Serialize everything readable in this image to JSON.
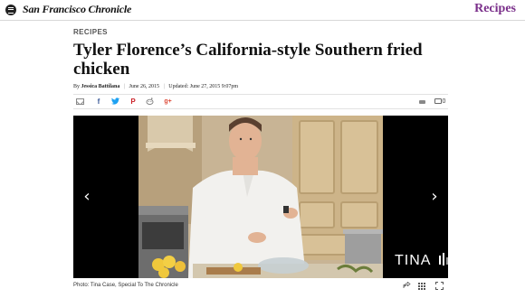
{
  "header": {
    "logo": "San Francisco Chronicle",
    "section": "Recipes"
  },
  "article": {
    "kicker": "RECIPES",
    "title": "Tyler Florence’s California-style Southern fried chicken",
    "byline": {
      "prefix": "By",
      "author": "Jessica Battilana",
      "published": "June 26, 2015",
      "updated": "Updated: June 27, 2015 9:07pm"
    },
    "comment_count": "0"
  },
  "gallery": {
    "watermark": "TINA",
    "caption": "Photo: Tina Case, Special To The Chronicle",
    "prev_glyph": "‹",
    "next_glyph": "›"
  },
  "icons": {
    "menu": "menu-icon",
    "email": "email-icon",
    "facebook": "facebook-icon",
    "twitter": "twitter-icon",
    "pinterest": "pinterest-icon",
    "reddit": "reddit-icon",
    "google_plus": "google-plus-icon",
    "print": "print-icon",
    "comment": "comment-icon",
    "share": "share-icon",
    "grid": "grid-icon",
    "fullscreen": "fullscreen-icon"
  },
  "colors": {
    "accent": "#7a2f8a",
    "facebook": "#3b5998",
    "twitter": "#1da1f2",
    "pinterest": "#cb2027",
    "google_plus": "#dd4b39"
  }
}
